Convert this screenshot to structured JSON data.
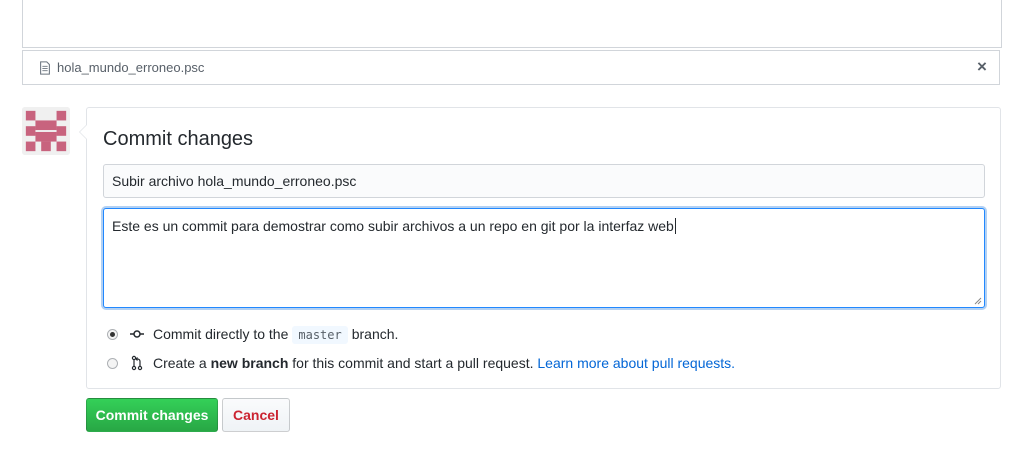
{
  "upload": {
    "file_name": "hola_mundo_erroneo.psc",
    "remove_symbol": "×"
  },
  "commit": {
    "title": "Commit changes",
    "summary_value": "Subir archivo hola_mundo_erroneo.psc",
    "description_value": "Este es un commit para demostrar como subir archivos a un repo en git por la interfaz web",
    "option_direct": {
      "prefix": "Commit directly to the",
      "branch": "master",
      "suffix": "branch.",
      "selected": true
    },
    "option_new_branch": {
      "prefix": "Create a",
      "bold": "new branch",
      "middle": "for this commit and start a pull request.",
      "link": "Learn more about pull requests.",
      "selected": false
    }
  },
  "buttons": {
    "commit_label": "Commit changes",
    "cancel_label": "Cancel"
  },
  "colors": {
    "primary_green": "#28a745",
    "cancel_red": "#cb2431",
    "link_blue": "#0366d6",
    "avatar_pink": "#c8637e"
  },
  "icons": {
    "file": "file-icon",
    "close": "close-icon",
    "commit": "git-commit-icon",
    "pull_request": "git-pull-request-icon"
  }
}
